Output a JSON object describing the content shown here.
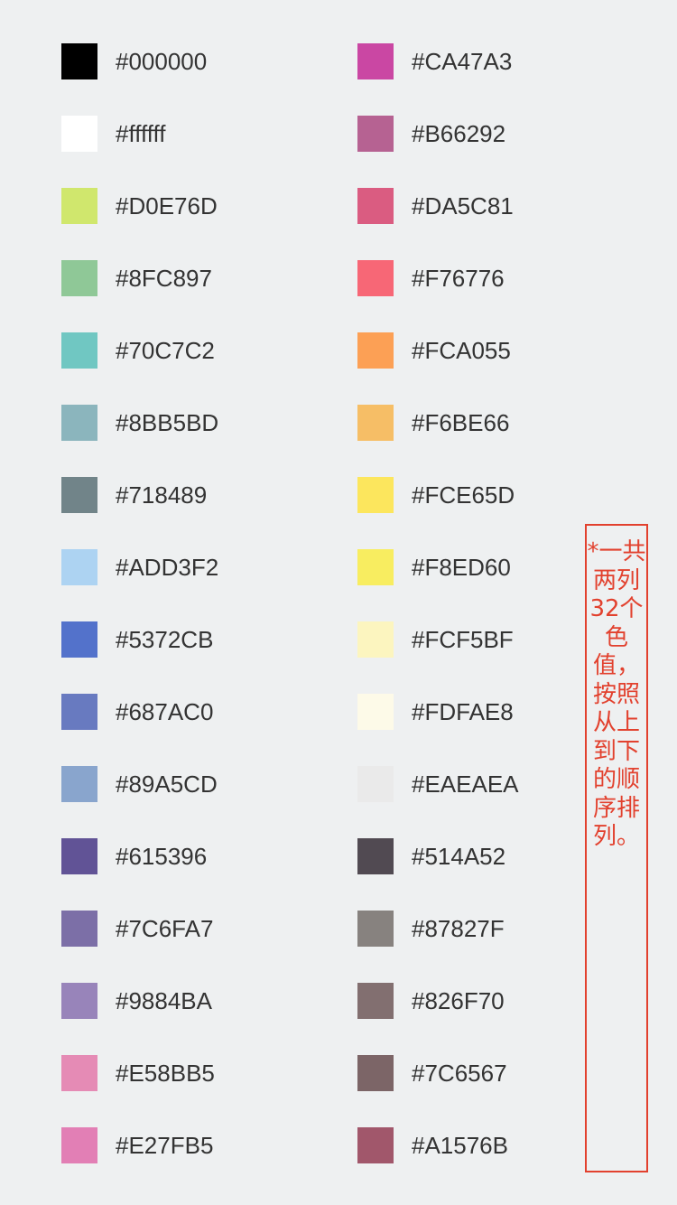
{
  "left_column": [
    {
      "code": "#000000",
      "color": "#000000"
    },
    {
      "code": "#ffffff",
      "color": "#ffffff"
    },
    {
      "code": "#D0E76D",
      "color": "#D0E76D"
    },
    {
      "code": "#8FC897",
      "color": "#8FC897"
    },
    {
      "code": "#70C7C2",
      "color": "#70C7C2"
    },
    {
      "code": "#8BB5BD",
      "color": "#8BB5BD"
    },
    {
      "code": "#718489",
      "color": "#718489"
    },
    {
      "code": "#ADD3F2",
      "color": "#ADD3F2"
    },
    {
      "code": "#5372CB",
      "color": "#5372CB"
    },
    {
      "code": "#687AC0",
      "color": "#687AC0"
    },
    {
      "code": "#89A5CD",
      "color": "#89A5CD"
    },
    {
      "code": "#615396",
      "color": "#615396"
    },
    {
      "code": "#7C6FA7",
      "color": "#7C6FA7"
    },
    {
      "code": "#9884BA",
      "color": "#9884BA"
    },
    {
      "code": "#E58BB5",
      "color": "#E58BB5"
    },
    {
      "code": "#E27FB5",
      "color": "#E27FB5"
    }
  ],
  "right_column": [
    {
      "code": "#CA47A3",
      "color": "#CA47A3"
    },
    {
      "code": "#B66292",
      "color": "#B66292"
    },
    {
      "code": "#DA5C81",
      "color": "#DA5C81"
    },
    {
      "code": "#F76776",
      "color": "#F76776"
    },
    {
      "code": "#FCA055",
      "color": "#FCA055"
    },
    {
      "code": "#F6BE66",
      "color": "#F6BE66"
    },
    {
      "code": "#FCE65D",
      "color": "#FCE65D"
    },
    {
      "code": "#F8ED60",
      "color": "#F8ED60"
    },
    {
      "code": "#FCF5BF",
      "color": "#FCF5BF"
    },
    {
      "code": "#FDFAE8",
      "color": "#FDFAE8"
    },
    {
      "code": "#EAEAEA",
      "color": "#EAEAEA"
    },
    {
      "code": "#514A52",
      "color": "#514A52"
    },
    {
      "code": "#87827F",
      "color": "#87827F"
    },
    {
      "code": "#826F70",
      "color": "#826F70"
    },
    {
      "code": "#7C6567",
      "color": "#7C6567"
    },
    {
      "code": "#A1576B",
      "color": "#A1576B"
    }
  ],
  "note": {
    "text": "*一共两列32个色值，按照从上到下的顺序排列。",
    "color": "#E2412E"
  },
  "background": "#EEF0F1"
}
